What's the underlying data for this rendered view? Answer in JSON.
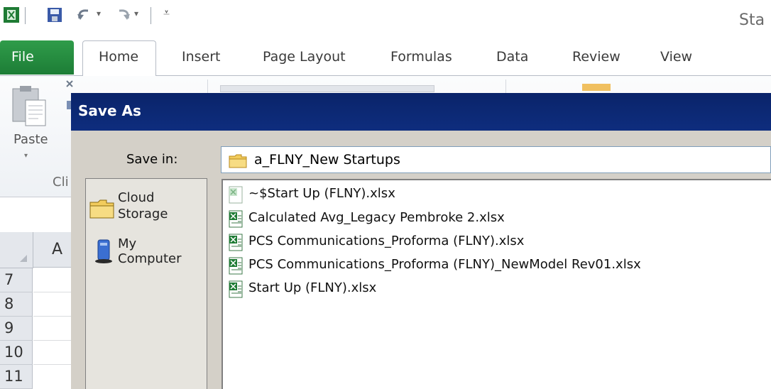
{
  "window": {
    "title_fragment": "Sta"
  },
  "ribbon": {
    "tabs": [
      "File",
      "Home",
      "Insert",
      "Page Layout",
      "Formulas",
      "Data",
      "Review",
      "View"
    ],
    "paste_label": "Paste",
    "clipboard_group": "Cli",
    "file_tab_color": "#1f8a3c"
  },
  "sheet": {
    "column_header": "A",
    "row_headers": [
      "7",
      "8",
      "9",
      "10",
      "11"
    ]
  },
  "dialog": {
    "title": "Save As",
    "save_in_label": "Save in:",
    "save_in_value": "a_FLNY_New Startups",
    "places": [
      {
        "label_line1": "Cloud",
        "label_line2": "Storage",
        "icon": "folder-icon"
      },
      {
        "label_line1": "My",
        "label_line2": "Computer",
        "icon": "my-computer-icon"
      }
    ],
    "files": [
      {
        "name": "~$Start Up (FLNY).xlsx",
        "icon": "excel-temp-file-icon"
      },
      {
        "name": "Calculated Avg_Legacy Pembroke 2.xlsx",
        "icon": "excel-file-icon"
      },
      {
        "name": "PCS Communications_Proforma (FLNY).xlsx",
        "icon": "excel-file-icon"
      },
      {
        "name": "PCS Communications_Proforma (FLNY)_NewModel Rev01.xlsx",
        "icon": "excel-file-icon"
      },
      {
        "name": "Start Up (FLNY).xlsx",
        "icon": "excel-file-icon"
      }
    ],
    "title_bar_color": "#0a246a"
  }
}
